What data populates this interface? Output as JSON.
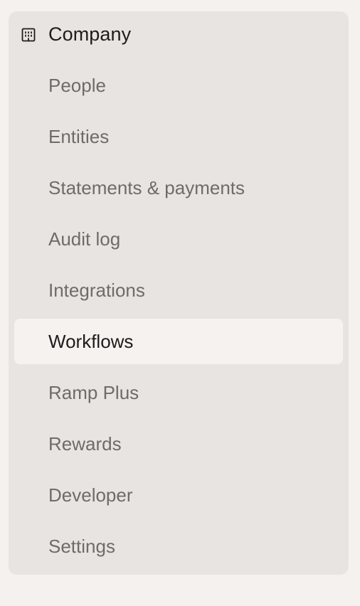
{
  "section": {
    "title": "Company",
    "icon": "building-icon"
  },
  "nav": {
    "active": "Workflows",
    "items": [
      {
        "label": "People",
        "name": "people"
      },
      {
        "label": "Entities",
        "name": "entities"
      },
      {
        "label": "Statements & payments",
        "name": "statements-payments"
      },
      {
        "label": "Audit log",
        "name": "audit-log"
      },
      {
        "label": "Integrations",
        "name": "integrations"
      },
      {
        "label": "Workflows",
        "name": "workflows"
      },
      {
        "label": "Ramp Plus",
        "name": "ramp-plus"
      },
      {
        "label": "Rewards",
        "name": "rewards"
      },
      {
        "label": "Developer",
        "name": "developer"
      },
      {
        "label": "Settings",
        "name": "settings"
      }
    ]
  },
  "colors": {
    "page_bg": "#f4f1ee",
    "panel_bg": "#e8e4e1",
    "active_bg": "#f5f2ef",
    "text_primary": "#1e1c1a",
    "text_muted": "#6f6b67"
  }
}
